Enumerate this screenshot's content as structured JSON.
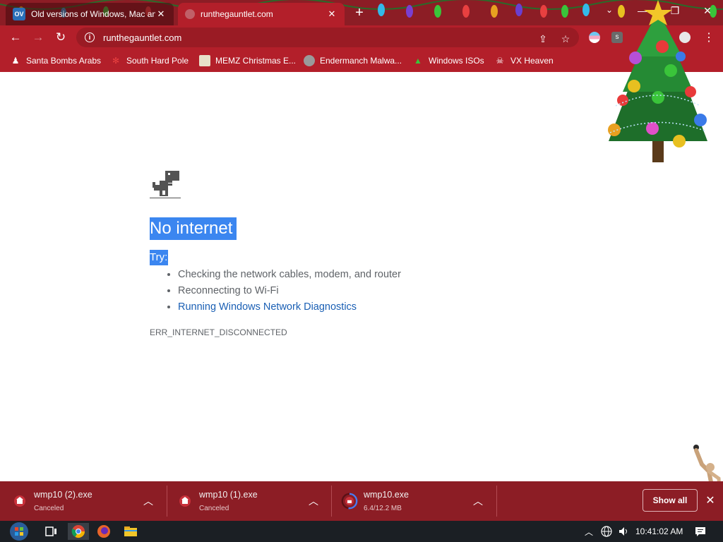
{
  "tabs": [
    {
      "title": "Old versions of Windows, Mac an",
      "favicon": "OV",
      "active": false
    },
    {
      "title": "runthegauntlet.com",
      "favicon": "globe-icon",
      "active": true
    }
  ],
  "toolbar": {
    "url": "runthegauntlet.com"
  },
  "bookmarks": [
    {
      "label": "Santa Bombs Arabs",
      "icon": "santa-icon"
    },
    {
      "label": "South Hard Pole",
      "icon": "snowflake-icon"
    },
    {
      "label": "MEMZ Christmas E...",
      "icon": "image-icon"
    },
    {
      "label": "Endermanch Malwa...",
      "icon": "raccoon-icon"
    },
    {
      "label": "Windows ISOs",
      "icon": "tree-icon"
    },
    {
      "label": "VX Heaven",
      "icon": "skull-icon"
    }
  ],
  "page": {
    "headline": "No internet",
    "try_label": "Try:",
    "suggestions": [
      "Checking the network cables, modem, and router",
      "Reconnecting to Wi-Fi",
      "Running Windows Network Diagnostics"
    ],
    "error_code": "ERR_INTERNET_DISCONNECTED"
  },
  "downloads": [
    {
      "name": "wmp10 (2).exe",
      "status": "Canceled"
    },
    {
      "name": "wmp10 (1).exe",
      "status": "Canceled"
    },
    {
      "name": "wmp10.exe",
      "status": "6.4/12.2 MB",
      "progress": 0.52
    }
  ],
  "shelf": {
    "show_all": "Show all"
  },
  "taskbar": {
    "clock": "10:41:02 AM"
  },
  "colors": {
    "theme_dark": "#8c1d25",
    "theme": "#b31f2a",
    "selection": "#3b86f0",
    "link": "#1a5fb4"
  }
}
